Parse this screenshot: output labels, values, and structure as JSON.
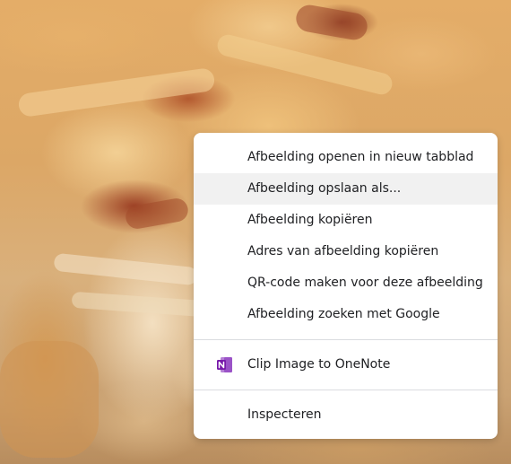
{
  "background": {
    "description_icon": "apple-pie-photo"
  },
  "menu": {
    "items": [
      {
        "label": "Afbeelding openen in nieuw tabblad"
      },
      {
        "label": "Afbeelding opslaan als..."
      },
      {
        "label": "Afbeelding kopiëren"
      },
      {
        "label": "Adres van afbeelding kopiëren"
      },
      {
        "label": "QR-code maken voor deze afbeelding"
      },
      {
        "label": "Afbeelding zoeken met Google"
      }
    ],
    "extension_item": {
      "label": "Clip Image to OneNote",
      "icon": "onenote-icon"
    },
    "inspect_item": {
      "label": "Inspecteren"
    },
    "highlighted_index": 1
  },
  "colors": {
    "menu_bg": "#ffffff",
    "hover_bg": "#f1f1f1",
    "text": "#202124",
    "separator": "#dadce0",
    "onenote_purple": "#7719aa"
  }
}
